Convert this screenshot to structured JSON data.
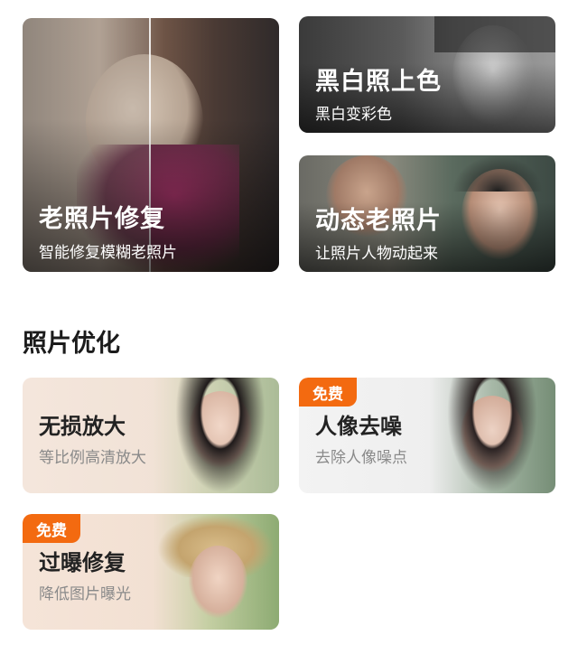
{
  "cards": {
    "old_photo_restore": {
      "title": "老照片修复",
      "subtitle": "智能修复模糊老照片"
    },
    "colorize": {
      "title": "黑白照上色",
      "subtitle": "黑白变彩色"
    },
    "animate": {
      "title": "动态老照片",
      "subtitle": "让照片人物动起来"
    }
  },
  "section": {
    "title": "照片优化"
  },
  "options": [
    {
      "title": "无损放大",
      "subtitle": "等比例高清放大",
      "badge": ""
    },
    {
      "title": "人像去噪",
      "subtitle": "去除人像噪点",
      "badge": "免费"
    },
    {
      "title": "过曝修复",
      "subtitle": "降低图片曝光",
      "badge": "免费"
    }
  ],
  "colors": {
    "badge": "#f36a10",
    "title": "#222222",
    "subtitle": "#8a8a8a"
  }
}
